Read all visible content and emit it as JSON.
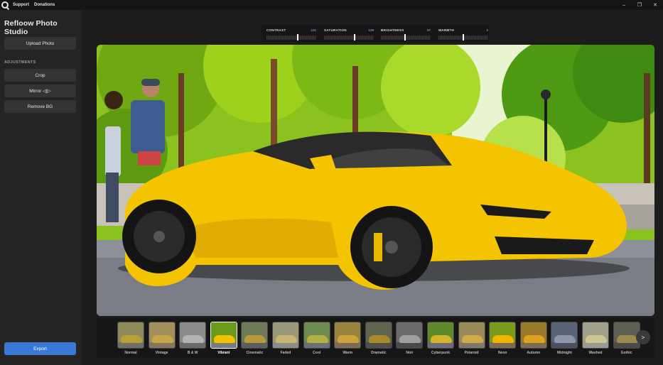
{
  "titlebar": {
    "menu": [
      "Support",
      "Donations"
    ],
    "controls": {
      "minimize": "–",
      "maximize": "❐",
      "close": "✕"
    }
  },
  "sidebar": {
    "title": "Refloow Photo Studio",
    "upload_label": "Upload Photo",
    "section_label": "ADJUSTMENTS",
    "crop_label": "Crop",
    "mirror_label": "Mirror ◁|▷",
    "remove_bg_label": "Remove BG",
    "export_label": "Export"
  },
  "sliders": [
    {
      "label": "CONTRAST",
      "value": "131",
      "fraction": 0.63
    },
    {
      "label": "SATURATION",
      "value": "129",
      "fraction": 0.62
    },
    {
      "label": "BRIGHTNESS",
      "value": "97",
      "fraction": 0.49
    },
    {
      "label": "WARMTH",
      "value": "0",
      "fraction": 0.5
    }
  ],
  "filters": [
    {
      "name": "Normal",
      "tone": "#8f8a5c",
      "car": "#b9a035",
      "road": "#6e6e6a",
      "selected": false
    },
    {
      "name": "Vintage",
      "tone": "#a38f5d",
      "car": "#c7a54b",
      "road": "#857662",
      "selected": false
    },
    {
      "name": "B & W",
      "tone": "#8a8a8a",
      "car": "#b3b3b3",
      "road": "#6a6a6a",
      "selected": false
    },
    {
      "name": "Vibrant",
      "tone": "#6a9a1a",
      "car": "#f2c200",
      "road": "#7a7a82",
      "selected": true
    },
    {
      "name": "Cinematic",
      "tone": "#6e7a58",
      "car": "#b89a3a",
      "road": "#5b5e60",
      "selected": false
    },
    {
      "name": "Faded",
      "tone": "#9a9a7a",
      "car": "#c8b676",
      "road": "#8d8d88",
      "selected": false
    },
    {
      "name": "Cool",
      "tone": "#6f8a50",
      "car": "#b5b040",
      "road": "#6a7078",
      "selected": false
    },
    {
      "name": "Warm",
      "tone": "#98833f",
      "car": "#d0a23a",
      "road": "#7a6d5a",
      "selected": false
    },
    {
      "name": "Dramatic",
      "tone": "#5e6450",
      "car": "#a88a2a",
      "road": "#4e4e4e",
      "selected": false
    },
    {
      "name": "Noir",
      "tone": "#6a6a6a",
      "car": "#a0a0a0",
      "road": "#4a4a4a",
      "selected": false
    },
    {
      "name": "Cyberpunk",
      "tone": "#5e8a2c",
      "car": "#d3b52a",
      "road": "#6f6a7c",
      "selected": false
    },
    {
      "name": "Polaroid",
      "tone": "#9a8a5a",
      "car": "#d3a847",
      "road": "#80786a",
      "selected": false
    },
    {
      "name": "Neon",
      "tone": "#7a9a1e",
      "car": "#f1b500",
      "road": "#7a6a5a",
      "selected": false
    },
    {
      "name": "Autumn",
      "tone": "#9a7a2a",
      "car": "#e0a020",
      "road": "#7e6c52",
      "selected": false
    },
    {
      "name": "Midnight",
      "tone": "#5a6478",
      "car": "#8e96a8",
      "road": "#4a5060",
      "selected": false
    },
    {
      "name": "Washed",
      "tone": "#a0a08a",
      "car": "#cfc58e",
      "road": "#9a9a92",
      "selected": false
    },
    {
      "name": "Gothic",
      "tone": "#5e5e52",
      "car": "#9a8a50",
      "road": "#4a4a46",
      "selected": false
    }
  ],
  "next_label": ">"
}
